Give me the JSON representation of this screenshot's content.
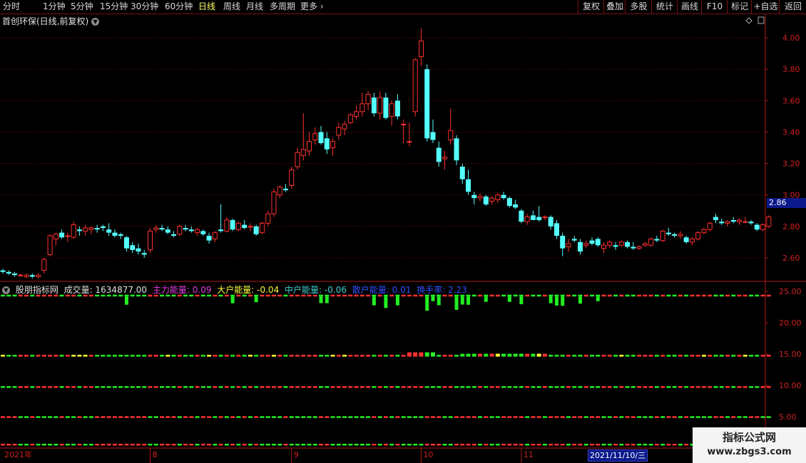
{
  "toolbar": {
    "tabs": [
      {
        "label": "分时",
        "active": false
      },
      {
        "label": "1分钟",
        "active": false
      },
      {
        "label": "5分钟",
        "active": false
      },
      {
        "label": "15分钟",
        "active": false
      },
      {
        "label": "30分钟",
        "active": false
      },
      {
        "label": "60分钟",
        "active": false
      },
      {
        "label": "日线",
        "active": true
      },
      {
        "label": "周线",
        "active": false
      },
      {
        "label": "月线",
        "active": false
      },
      {
        "label": "多周期",
        "active": false
      },
      {
        "label": "更多 ›",
        "active": false
      }
    ],
    "buttons": [
      "复权",
      "叠加",
      "多股",
      "统计",
      "画线",
      "F10",
      "标记",
      "+自选",
      "返回"
    ]
  },
  "main_title": "首创环保(日线,前复权)",
  "price_tag": "2.86",
  "indicator": {
    "name": "股朋指标网",
    "volume": "成交量: 1634877.00",
    "items": [
      {
        "label": "主力能量: 0.09",
        "color": "#e040e0"
      },
      {
        "label": "大户能量: -0.04",
        "color": "#ffff40"
      },
      {
        "label": "中户能量: -0.06",
        "color": "#40d0d0"
      },
      {
        "label": "散户能量: 0.01",
        "color": "#3050ff"
      },
      {
        "label": "换手率: 2.23",
        "color": "#3050ff"
      }
    ]
  },
  "date_tag": "2021/11/10/三",
  "watermark": {
    "title": "指标公式网",
    "url": "www.zbgs3.com"
  },
  "colors": {
    "up": "#ff3030",
    "down": "#54ffff",
    "grid": "#7a1010",
    "axis": "#b01818",
    "green": "#22ee22",
    "yellow": "#ffff30"
  },
  "chart_data": [
    {
      "type": "candlestick",
      "title": "首创环保(日线,前复权)",
      "ylim": [
        2.45,
        4.15
      ],
      "yticks": [
        2.6,
        2.8,
        3.0,
        3.2,
        3.4,
        3.6,
        3.8,
        4.0
      ],
      "ytick_labels": [
        "2.60",
        "2.80",
        "3.00",
        "3.20",
        "3.40",
        "3.60",
        "3.80",
        "4.00"
      ],
      "xaxis_labels": [
        {
          "label": "2021年",
          "index": 0
        },
        {
          "label": "8",
          "index": 25
        },
        {
          "label": "9",
          "index": 49
        },
        {
          "label": "10",
          "index": 71
        },
        {
          "label": "11",
          "index": 88
        }
      ],
      "ohlc": [
        [
          2.52,
          2.53,
          2.5,
          2.51
        ],
        [
          2.51,
          2.52,
          2.49,
          2.5
        ],
        [
          2.5,
          2.51,
          2.48,
          2.49
        ],
        [
          2.49,
          2.5,
          2.48,
          2.49
        ],
        [
          2.48,
          2.5,
          2.47,
          2.49
        ],
        [
          2.49,
          2.5,
          2.47,
          2.48
        ],
        [
          2.48,
          2.5,
          2.47,
          2.49
        ],
        [
          2.52,
          2.6,
          2.5,
          2.59
        ],
        [
          2.62,
          2.75,
          2.61,
          2.74
        ],
        [
          2.72,
          2.76,
          2.68,
          2.75
        ],
        [
          2.76,
          2.78,
          2.72,
          2.73
        ],
        [
          2.74,
          2.76,
          2.7,
          2.74
        ],
        [
          2.73,
          2.83,
          2.72,
          2.81
        ],
        [
          2.78,
          2.8,
          2.74,
          2.77
        ],
        [
          2.77,
          2.81,
          2.74,
          2.79
        ],
        [
          2.78,
          2.8,
          2.75,
          2.79
        ],
        [
          2.79,
          2.81,
          2.76,
          2.78
        ],
        [
          2.8,
          2.81,
          2.77,
          2.79
        ],
        [
          2.78,
          2.82,
          2.74,
          2.76
        ],
        [
          2.76,
          2.78,
          2.73,
          2.74
        ],
        [
          2.75,
          2.76,
          2.72,
          2.74
        ],
        [
          2.73,
          2.74,
          2.64,
          2.66
        ],
        [
          2.68,
          2.7,
          2.63,
          2.65
        ],
        [
          2.66,
          2.69,
          2.62,
          2.64
        ],
        [
          2.63,
          2.65,
          2.6,
          2.62
        ],
        [
          2.65,
          2.79,
          2.63,
          2.77
        ],
        [
          2.78,
          2.81,
          2.76,
          2.79
        ],
        [
          2.79,
          2.81,
          2.77,
          2.78
        ],
        [
          2.78,
          2.8,
          2.75,
          2.76
        ],
        [
          2.75,
          2.77,
          2.73,
          2.74
        ],
        [
          2.75,
          2.81,
          2.74,
          2.8
        ],
        [
          2.79,
          2.81,
          2.77,
          2.78
        ],
        [
          2.78,
          2.8,
          2.76,
          2.77
        ],
        [
          2.76,
          2.79,
          2.74,
          2.78
        ],
        [
          2.77,
          2.78,
          2.74,
          2.75
        ],
        [
          2.74,
          2.76,
          2.69,
          2.71
        ],
        [
          2.72,
          2.77,
          2.7,
          2.76
        ],
        [
          2.78,
          2.94,
          2.76,
          2.77
        ],
        [
          2.77,
          2.86,
          2.76,
          2.84
        ],
        [
          2.84,
          2.85,
          2.77,
          2.78
        ],
        [
          2.78,
          2.83,
          2.77,
          2.82
        ],
        [
          2.81,
          2.84,
          2.78,
          2.79
        ],
        [
          2.8,
          2.82,
          2.77,
          2.8
        ],
        [
          2.8,
          2.81,
          2.74,
          2.75
        ],
        [
          2.76,
          2.83,
          2.75,
          2.82
        ],
        [
          2.82,
          2.9,
          2.8,
          2.88
        ],
        [
          2.88,
          3.04,
          2.86,
          3.02
        ],
        [
          3.0,
          3.06,
          2.98,
          3.05
        ],
        [
          3.04,
          3.07,
          3.02,
          3.03
        ],
        [
          3.06,
          3.18,
          3.04,
          3.16
        ],
        [
          3.18,
          3.3,
          3.16,
          3.27
        ],
        [
          3.25,
          3.52,
          3.22,
          3.29
        ],
        [
          3.28,
          3.4,
          3.25,
          3.34
        ],
        [
          3.35,
          3.43,
          3.32,
          3.39
        ],
        [
          3.4,
          3.44,
          3.32,
          3.33
        ],
        [
          3.36,
          3.4,
          3.26,
          3.29
        ],
        [
          3.3,
          3.36,
          3.25,
          3.34
        ],
        [
          3.38,
          3.46,
          3.35,
          3.43
        ],
        [
          3.42,
          3.47,
          3.38,
          3.45
        ],
        [
          3.46,
          3.52,
          3.45,
          3.51
        ],
        [
          3.5,
          3.57,
          3.48,
          3.53
        ],
        [
          3.53,
          3.65,
          3.5,
          3.58
        ],
        [
          3.58,
          3.66,
          3.54,
          3.64
        ],
        [
          3.62,
          3.65,
          3.5,
          3.52
        ],
        [
          3.52,
          3.66,
          3.48,
          3.62
        ],
        [
          3.62,
          3.65,
          3.48,
          3.49
        ],
        [
          3.5,
          3.6,
          3.44,
          3.58
        ],
        [
          3.6,
          3.64,
          3.48,
          3.5
        ],
        [
          3.45,
          3.48,
          3.33,
          3.45
        ],
        [
          3.34,
          3.46,
          3.31,
          3.34
        ],
        [
          3.53,
          3.87,
          3.5,
          3.86
        ],
        [
          3.88,
          4.06,
          3.82,
          3.98
        ],
        [
          3.8,
          3.83,
          3.34,
          3.36
        ],
        [
          3.4,
          3.48,
          3.33,
          3.35
        ],
        [
          3.3,
          3.34,
          3.18,
          3.21
        ],
        [
          3.23,
          3.28,
          3.16,
          3.24
        ],
        [
          3.35,
          3.55,
          3.32,
          3.41
        ],
        [
          3.36,
          3.38,
          3.19,
          3.22
        ],
        [
          3.18,
          3.2,
          3.07,
          3.1
        ],
        [
          3.1,
          3.16,
          3.0,
          3.02
        ],
        [
          3.0,
          3.02,
          2.94,
          2.98
        ],
        [
          2.98,
          3.01,
          2.96,
          2.99
        ],
        [
          2.99,
          3.0,
          2.93,
          2.94
        ],
        [
          2.96,
          2.99,
          2.94,
          2.98
        ],
        [
          2.97,
          3.01,
          2.95,
          3.0
        ],
        [
          3.0,
          3.02,
          2.97,
          2.98
        ],
        [
          2.98,
          2.99,
          2.92,
          2.93
        ],
        [
          2.94,
          2.97,
          2.91,
          2.92
        ],
        [
          2.9,
          2.91,
          2.82,
          2.83
        ],
        [
          2.83,
          2.88,
          2.81,
          2.86
        ],
        [
          2.87,
          2.9,
          2.84,
          2.84
        ],
        [
          2.86,
          2.93,
          2.83,
          2.84
        ],
        [
          2.86,
          2.87,
          2.84,
          2.86
        ],
        [
          2.86,
          2.87,
          2.78,
          2.8
        ],
        [
          2.82,
          2.84,
          2.72,
          2.74
        ],
        [
          2.74,
          2.76,
          2.61,
          2.66
        ],
        [
          2.67,
          2.72,
          2.64,
          2.69
        ],
        [
          2.72,
          2.74,
          2.7,
          2.71
        ],
        [
          2.7,
          2.72,
          2.62,
          2.64
        ],
        [
          2.68,
          2.71,
          2.66,
          2.69
        ],
        [
          2.71,
          2.73,
          2.68,
          2.69
        ],
        [
          2.72,
          2.73,
          2.67,
          2.68
        ],
        [
          2.66,
          2.7,
          2.63,
          2.68
        ],
        [
          2.68,
          2.71,
          2.66,
          2.7
        ],
        [
          2.68,
          2.7,
          2.65,
          2.67
        ],
        [
          2.68,
          2.71,
          2.67,
          2.7
        ],
        [
          2.7,
          2.71,
          2.66,
          2.67
        ],
        [
          2.67,
          2.7,
          2.65,
          2.66
        ],
        [
          2.66,
          2.68,
          2.65,
          2.67
        ],
        [
          2.68,
          2.7,
          2.67,
          2.69
        ],
        [
          2.68,
          2.73,
          2.67,
          2.72
        ],
        [
          2.72,
          2.74,
          2.7,
          2.71
        ],
        [
          2.71,
          2.78,
          2.7,
          2.77
        ],
        [
          2.76,
          2.79,
          2.74,
          2.75
        ],
        [
          2.75,
          2.76,
          2.73,
          2.74
        ],
        [
          2.74,
          2.77,
          2.72,
          2.75
        ],
        [
          2.73,
          2.74,
          2.69,
          2.7
        ],
        [
          2.7,
          2.73,
          2.68,
          2.72
        ],
        [
          2.72,
          2.77,
          2.71,
          2.76
        ],
        [
          2.76,
          2.79,
          2.75,
          2.78
        ],
        [
          2.78,
          2.83,
          2.77,
          2.82
        ],
        [
          2.86,
          2.88,
          2.82,
          2.84
        ],
        [
          2.83,
          2.85,
          2.81,
          2.82
        ],
        [
          2.82,
          2.84,
          2.8,
          2.83
        ],
        [
          2.84,
          2.86,
          2.82,
          2.83
        ],
        [
          2.83,
          2.85,
          2.81,
          2.84
        ],
        [
          2.83,
          2.86,
          2.82,
          2.83
        ],
        [
          2.83,
          2.84,
          2.81,
          2.82
        ],
        [
          2.81,
          2.82,
          2.77,
          2.78
        ],
        [
          2.78,
          2.82,
          2.77,
          2.81
        ],
        [
          2.8,
          2.87,
          2.79,
          2.86
        ]
      ]
    },
    {
      "type": "bar",
      "title": "股朋指标网",
      "ylim": [
        0,
        26.5
      ],
      "yticks": [
        5,
        10,
        15,
        20,
        25
      ],
      "ytick_labels": [
        "5.00",
        "10.00",
        "15.00",
        "20.00",
        "25.00"
      ]
    }
  ]
}
